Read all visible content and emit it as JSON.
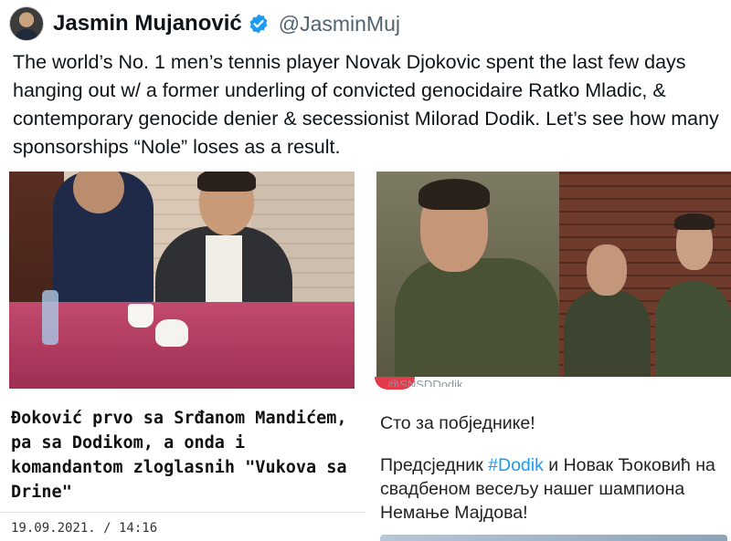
{
  "author": {
    "display_name": "Jasmin Mujanović",
    "handle": "@JasminMuj",
    "verified": true,
    "verified_color": "#1d9bf0"
  },
  "tweet": {
    "text": "The world’s No. 1 men’s tennis player Novak Djokovic spent the last few days hanging out w/ a former underling of convicted genocidaire Ratko Mladic, & contemporary genocide denier & secessionist Milorad Dodik. Let’s see how many sponsorships “Nole” loses as a result."
  },
  "media_left": {
    "headline": "Đoković prvo sa Srđanom Mandićem, pa sa Dodikom, a onda i komandantom zloglasnih \"Vukova sa Drine\"",
    "date": "19.09.2021. / 14:16"
  },
  "media_right": {
    "partial_handle": "@SNSDDodik",
    "line1": "Сто за побједнике!",
    "line2_prefix": "Предсједник ",
    "hashtag": "#Dodik",
    "line2_suffix": " и Новак Ђоковић на свадбеном весељу нашег шампиона Немање Мајдова!",
    "hashtag_color": "#1d9bf0"
  }
}
